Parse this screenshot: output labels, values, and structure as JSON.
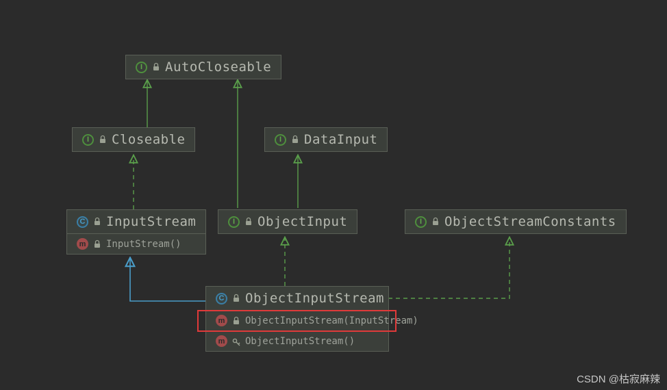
{
  "nodes": {
    "autoCloseable": {
      "label": "AutoCloseable",
      "kind": "interface"
    },
    "closeable": {
      "label": "Closeable",
      "kind": "interface"
    },
    "dataInput": {
      "label": "DataInput",
      "kind": "interface"
    },
    "inputStream": {
      "label": "InputStream",
      "kind": "class",
      "members": [
        {
          "label": "InputStream()",
          "kind": "method"
        }
      ]
    },
    "objectInput": {
      "label": "ObjectInput",
      "kind": "interface"
    },
    "objectStreamConstants": {
      "label": "ObjectStreamConstants",
      "kind": "interface"
    },
    "objectInputStream": {
      "label": "ObjectInputStream",
      "kind": "class",
      "members": [
        {
          "label": "ObjectInputStream(InputStream)",
          "kind": "method",
          "highlighted": true
        },
        {
          "label": "ObjectInputStream()",
          "kind": "method",
          "protected": true
        }
      ]
    }
  },
  "edges": [
    {
      "from": "closeable",
      "to": "autoCloseable",
      "type": "extends-interface"
    },
    {
      "from": "inputStream",
      "to": "closeable",
      "type": "implements"
    },
    {
      "from": "objectInput",
      "to": "autoCloseable",
      "type": "extends-interface"
    },
    {
      "from": "objectInput",
      "to": "dataInput",
      "type": "extends-interface"
    },
    {
      "from": "objectInputStream",
      "to": "inputStream",
      "type": "extends-class"
    },
    {
      "from": "objectInputStream",
      "to": "objectInput",
      "type": "implements"
    },
    {
      "from": "objectInputStream",
      "to": "objectStreamConstants",
      "type": "implements"
    }
  ],
  "watermark": "CSDN @枯寂麻辣"
}
